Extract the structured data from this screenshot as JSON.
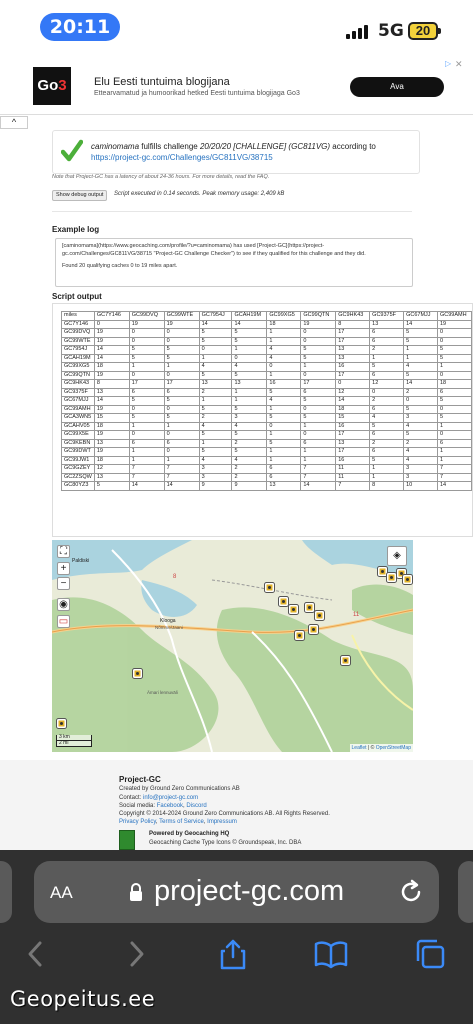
{
  "status": {
    "time": "20:11",
    "network": "5G",
    "battery": "20"
  },
  "ad": {
    "logo_text": "Go",
    "logo_mark": "3",
    "title": "Elu Eesti tuntuima blogijana",
    "subtitle": "Ettearvamatud ja humoorikad hetked Eesti tuntuima blogijaga Go3",
    "button": "Ava",
    "close": "✕"
  },
  "collapse_icon": "^",
  "result": {
    "user": "caminomama",
    "text_mid": " fulfills challenge ",
    "challenge": "20/20/20 [CHALLENGE] (GC811VG)",
    "text_end": " according to",
    "link": "https://project-gc.com/Challenges/GC811VG/38715"
  },
  "latency_note": "Note that Project-GC has a latency of about 24-36 hours. For more details, read the FAQ.",
  "debug_button": "Show debug output",
  "script_exec": "Script executed in 0.14 seconds. Peak memory usage: 2,409 kB",
  "example_log_heading": "Example log",
  "example_log": [
    "[caminomama](https://www.geocaching.com/profile/?u=caminomama) has used [Project-GC](https://project-gc.com/Challenges/GC811VG/38715 \"Project-GC Challenge Checker\") to see if they qualified for this challenge and they did.",
    "Found 20 qualifying caches 0 to 19 miles apart."
  ],
  "script_output_heading": "Script output",
  "table": {
    "headers": [
      "miles",
      "GC7Y146",
      "GC99DVQ",
      "GC99WTE",
      "GC7954J",
      "GCAH19M",
      "GC99XG5",
      "GC99QTN",
      "GC9HK43",
      "GC9375F",
      "GC67MJJ",
      "GC99AMH"
    ],
    "rows": [
      [
        "GC7Y146",
        "0",
        "19",
        "19",
        "14",
        "14",
        "18",
        "19",
        "8",
        "13",
        "14",
        "19"
      ],
      [
        "GC99DVQ",
        "19",
        "0",
        "0",
        "5",
        "5",
        "1",
        "0",
        "17",
        "6",
        "5",
        "0"
      ],
      [
        "GC99WTE",
        "19",
        "0",
        "0",
        "5",
        "5",
        "1",
        "0",
        "17",
        "6",
        "5",
        "0"
      ],
      [
        "GC7954J",
        "14",
        "5",
        "5",
        "0",
        "1",
        "4",
        "5",
        "13",
        "2",
        "1",
        "5"
      ],
      [
        "GCAH19M",
        "14",
        "5",
        "5",
        "1",
        "0",
        "4",
        "5",
        "13",
        "1",
        "1",
        "5"
      ],
      [
        "GC99XG5",
        "18",
        "1",
        "1",
        "4",
        "4",
        "0",
        "1",
        "16",
        "5",
        "4",
        "1"
      ],
      [
        "GC99QTN",
        "19",
        "0",
        "0",
        "5",
        "5",
        "1",
        "0",
        "17",
        "6",
        "5",
        "0"
      ],
      [
        "GC9HK43",
        "8",
        "17",
        "17",
        "13",
        "13",
        "16",
        "17",
        "0",
        "12",
        "14",
        "18"
      ],
      [
        "GC9375F",
        "13",
        "6",
        "6",
        "2",
        "1",
        "5",
        "6",
        "12",
        "0",
        "2",
        "6"
      ],
      [
        "GC67MJJ",
        "14",
        "5",
        "5",
        "1",
        "1",
        "4",
        "5",
        "14",
        "2",
        "0",
        "5"
      ],
      [
        "GC99AMH",
        "19",
        "0",
        "0",
        "5",
        "5",
        "1",
        "0",
        "18",
        "6",
        "5",
        "0"
      ],
      [
        "GCA3WN5",
        "15",
        "5",
        "5",
        "2",
        "3",
        "5",
        "5",
        "15",
        "4",
        "3",
        "5"
      ],
      [
        "GCAHV05",
        "18",
        "1",
        "1",
        "4",
        "4",
        "0",
        "1",
        "16",
        "5",
        "4",
        "1"
      ],
      [
        "GC99X5E",
        "19",
        "0",
        "0",
        "5",
        "5",
        "1",
        "0",
        "17",
        "6",
        "5",
        "0"
      ],
      [
        "GC9KEBN",
        "13",
        "6",
        "6",
        "1",
        "2",
        "5",
        "6",
        "13",
        "2",
        "2",
        "6"
      ],
      [
        "GC99DWT",
        "19",
        "1",
        "0",
        "5",
        "5",
        "1",
        "1",
        "17",
        "6",
        "4",
        "1"
      ],
      [
        "GC99JW1",
        "18",
        "1",
        "1",
        "4",
        "4",
        "1",
        "1",
        "16",
        "5",
        "4",
        "1"
      ],
      [
        "GC9GZEY",
        "12",
        "7",
        "7",
        "3",
        "2",
        "6",
        "7",
        "11",
        "1",
        "3",
        "7"
      ],
      [
        "GC2ZSQW",
        "13",
        "7",
        "7",
        "3",
        "2",
        "6",
        "7",
        "11",
        "1",
        "3",
        "7"
      ],
      [
        "GC80YZ3",
        "5",
        "14",
        "14",
        "9",
        "9",
        "13",
        "14",
        "7",
        "8",
        "10",
        "14"
      ]
    ]
  },
  "map": {
    "labels": {
      "paldiski": "Paldiski",
      "klooga": "Klooga",
      "klooga_sub": "Nõmme/Jaani",
      "amari": "Ämari lennuväli",
      "road": "11",
      "road2": "8"
    },
    "scale": {
      "km": "3 km",
      "mi": "2 mi"
    },
    "zoom_in": "+",
    "zoom_out": "−",
    "attribution_leaflet": "Leaflet",
    "attribution_sep": " | © ",
    "attribution_osm": "OpenStreetMap"
  },
  "footer": {
    "title": "Project-GC",
    "created": "Created by Ground Zero Communications AB",
    "contact_label": "Contact: ",
    "contact_email": "info@project-gc.com",
    "social_label": "Social media: ",
    "facebook": "Facebook",
    "discord": "Discord",
    "copyright": "Copyright © 2014-2024 Ground Zero Communications AB. All Rights Reserved.",
    "privacy": "Privacy Policy",
    "terms": "Terms of Service",
    "impressum": "Impressum",
    "powered": "Powered by Geocaching HQ",
    "icons": "Geocaching Cache Type Icons © Groundspeak, Inc. DBA"
  },
  "safari": {
    "aa": "AA",
    "url": "project-gc.com"
  },
  "watermark": "Geopeitus.ee",
  "colors": {
    "accent": "#3478f6",
    "link": "#2672c0",
    "check": "#4caf3a",
    "safari_bg": "#303030"
  }
}
